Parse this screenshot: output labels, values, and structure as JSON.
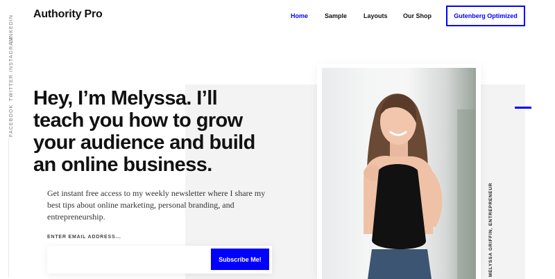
{
  "social": {
    "linkedin": "LINKEDIN",
    "instagram": "INSTAGRAM",
    "twitter": "TWITTER",
    "facebook": "FACEBOOK"
  },
  "header": {
    "logo": "Authority Pro",
    "nav": {
      "home": "Home",
      "sample": "Sample",
      "layouts": "Layouts",
      "shop": "Our Shop",
      "cta": "Gutenberg Optimized"
    }
  },
  "hero": {
    "headline": "Hey, I’m Melyssa. I’ll teach you how to grow your audience and build an online business.",
    "intro": "Get instant free access to my weekly newsletter where I share my best tips about online marketing, personal branding, and entrepreneurship.",
    "email_label": "ENTER EMAIL ADDRESS...",
    "email_value": "",
    "subscribe_label": "Subscribe Me!",
    "photo_caption": "MELYSSA GRIFFIN, ENTREPRENEUR"
  },
  "colors": {
    "accent": "#0000ff",
    "panel": "#f3f3f3",
    "text": "#111111"
  }
}
